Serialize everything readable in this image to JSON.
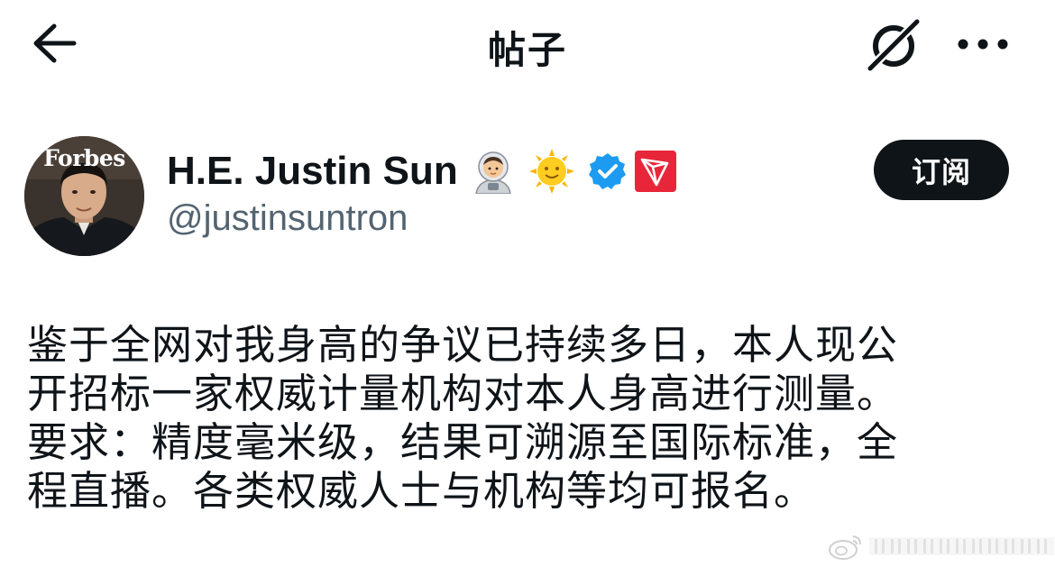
{
  "header": {
    "title": "帖子",
    "back_icon": "back-arrow-icon",
    "grok_icon": "grok-icon",
    "more_icon": "more-horizontal-icon"
  },
  "profile": {
    "display_name": "H.E. Justin Sun",
    "handle": "@justinsuntron",
    "avatar_text": "Forbes",
    "badges": [
      "astronaut-emoji",
      "sun-with-face-emoji",
      "verified-badge-icon",
      "tron-logo-icon"
    ],
    "subscribe_label": "订阅"
  },
  "post": {
    "lines": [
      "鉴于全网对我身高的争议已持续多日，本人现公",
      "开招标一家权威计量机构对本人身高进行测量。",
      "要求：精度毫米级，结果可溯源至国际标准，全",
      "程直播。各类权威人士与机构等均可报名。"
    ]
  },
  "watermark": {
    "icon": "weibo-logo-icon"
  },
  "colors": {
    "text_primary": "#0f1419",
    "text_secondary": "#536471",
    "verified_blue": "#1d9bf0",
    "tron_red": "#e8263a",
    "button_bg": "#0f1419"
  }
}
